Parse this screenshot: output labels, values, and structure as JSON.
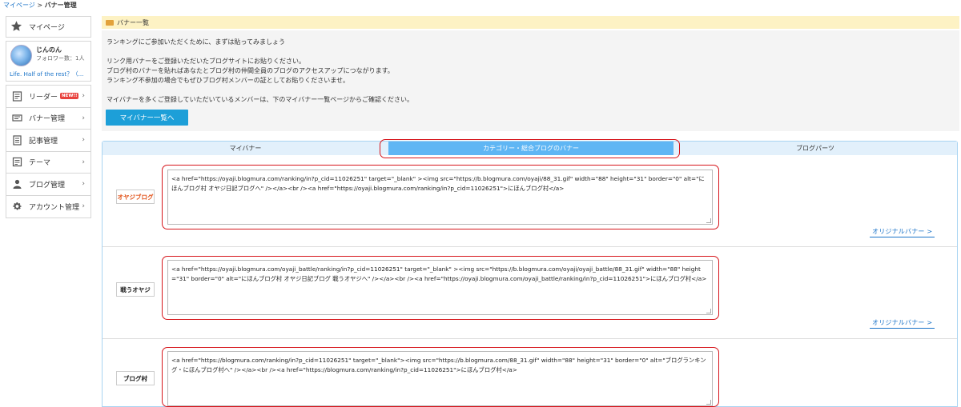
{
  "breadcrumb": {
    "link": "マイページ",
    "sep": " > ",
    "current": "バナー管理"
  },
  "sidebar": {
    "mypage": "マイページ",
    "profile": {
      "name": "じんのん",
      "followers": "フォロワー数：1人",
      "tagline": "Life. Half of the rest？（..."
    },
    "items": [
      {
        "label": "リーダー",
        "badge": "NEW!!",
        "icon": "reader-icon"
      },
      {
        "label": "バナー管理",
        "icon": "banner-icon"
      },
      {
        "label": "記事管理",
        "icon": "article-icon"
      },
      {
        "label": "テーマ",
        "icon": "theme-icon"
      },
      {
        "label": "ブログ管理",
        "icon": "blog-user-icon"
      },
      {
        "label": "アカウント管理",
        "icon": "gear-icon"
      }
    ],
    "chevron": "›"
  },
  "section": {
    "title": "バナー一覧"
  },
  "intro": {
    "line1": "ランキングにご参加いただくために、まずは貼ってみましょう",
    "line2": "リンク用バナーをご登録いただいたブログサイトにお貼りください。",
    "line3": "ブログ村のバナーを貼ればあなたとブログ村の仲間全員のブログのアクセスアップにつながります。",
    "line4": "ランキング不参加の場合でもぜひブログ村メンバーの証としてお貼りくださいませ。",
    "line5": "マイバナーを多くご登録していただいているメンバーは、下のマイバナー一覧ページからご確認ください。",
    "button": "マイバナー一覧へ"
  },
  "tabs": [
    "マイバナー",
    "カテゴリー・総合ブログのバナー",
    "ブログパーツ"
  ],
  "banners": [
    {
      "logo": "オヤジブログ",
      "code": "<a href=\"https://oyaji.blogmura.com/ranking/in?p_cid=11026251\" target=\"_blank\" ><img src=\"https://b.blogmura.com/oyaji/88_31.gif\" width=\"88\" height=\"31\" border=\"0\" alt=\"にほんブログ村 オヤジ日記ブログへ\" /></a><br /><a href=\"https://oyaji.blogmura.com/ranking/in?p_cid=11026251\">にほんブログ村</a>",
      "original": "オリジナルバナー >"
    },
    {
      "logo": "戦うオヤジ",
      "code": "<a href=\"https://oyaji.blogmura.com/oyaji_battle/ranking/in?p_cid=11026251\" target=\"_blank\" ><img src=\"https://b.blogmura.com/oyaji/oyaji_battle/88_31.gif\" width=\"88\" height=\"31\" border=\"0\" alt=\"にほんブログ村 オヤジ日記ブログ 戦うオヤジへ\" /></a><br /><a href=\"https://oyaji.blogmura.com/oyaji_battle/ranking/in?p_cid=11026251\">にほんブログ村</a>",
      "original": "オリジナルバナー >"
    },
    {
      "logo": "ブログ村",
      "code": "<a href=\"https://blogmura.com/ranking/in?p_cid=11026251\" target=\"_blank\"><img src=\"https://b.blogmura.com/88_31.gif\" width=\"88\" height=\"31\" border=\"0\" alt=\"ブログランキング・にほんブログ村へ\" /></a><br /><a href=\"https://blogmura.com/ranking/in?p_cid=11026251\">にほんブログ村</a>"
    }
  ],
  "colors": {
    "accent": "#1d9fd8",
    "tabActive": "#5fb6f4",
    "highlight": "#d6151b",
    "header": "#fdf2c4"
  }
}
